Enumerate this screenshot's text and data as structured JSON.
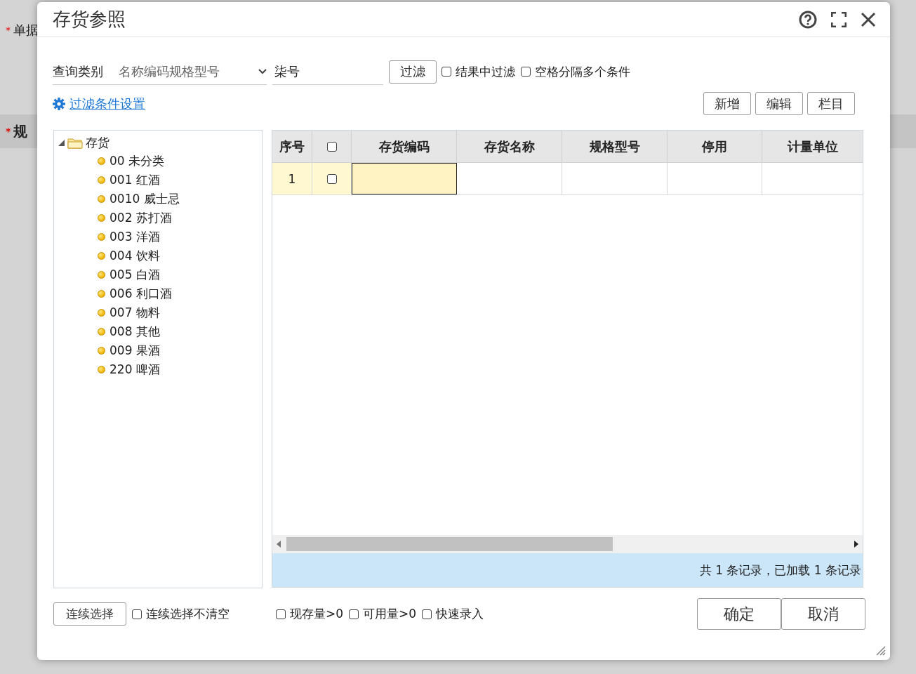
{
  "background": {
    "labels": [
      {
        "mark": "*",
        "text": "单据"
      },
      {
        "mark": "*",
        "text": "规"
      }
    ]
  },
  "dialog": {
    "title": "存货参照"
  },
  "query": {
    "category_label": "查询类别",
    "category_value": "名称编码规格型号",
    "search_value": "柒号",
    "filter_button": "过滤",
    "options": [
      {
        "label": "结果中过滤",
        "checked": false
      },
      {
        "label": "空格分隔多个条件",
        "checked": false
      }
    ]
  },
  "filter_settings_link": "过滤条件设置",
  "toolbar_buttons": [
    "新增",
    "编辑",
    "栏目"
  ],
  "tree": {
    "label": "存货",
    "expanded": true,
    "children": [
      {
        "label": "00 未分类"
      },
      {
        "label": "001 红酒"
      },
      {
        "label": "0010 威士忌"
      },
      {
        "label": "002 苏打酒"
      },
      {
        "label": "003 洋酒"
      },
      {
        "label": "004 饮料"
      },
      {
        "label": "005 白酒"
      },
      {
        "label": "006 利口酒"
      },
      {
        "label": "007 物料"
      },
      {
        "label": "008 其他"
      },
      {
        "label": "009 果酒"
      },
      {
        "label": "220 啤酒"
      }
    ]
  },
  "table": {
    "columns": [
      {
        "kind": "text",
        "label": "序号"
      },
      {
        "kind": "checkbox",
        "checked": false
      },
      {
        "kind": "text",
        "label": "存货编码"
      },
      {
        "kind": "text",
        "label": "存货名称"
      },
      {
        "kind": "text",
        "label": "规格型号"
      },
      {
        "kind": "text",
        "label": "停用"
      },
      {
        "kind": "text",
        "label": "计量单位"
      }
    ],
    "rows": [
      {
        "number": "1",
        "checked": false,
        "selected": true
      }
    ]
  },
  "status": "共 1 条记录，已加载 1 条记录",
  "footer": {
    "continuous_button": "连续选择",
    "continuous_option": {
      "label": "连续选择不清空",
      "checked": false
    },
    "options": [
      {
        "label": "现存量>0",
        "checked": false
      },
      {
        "label": "可用量>0",
        "checked": false
      },
      {
        "label": "快速录入",
        "checked": false
      }
    ],
    "confirm_button": "确定",
    "cancel_button": "取消"
  }
}
